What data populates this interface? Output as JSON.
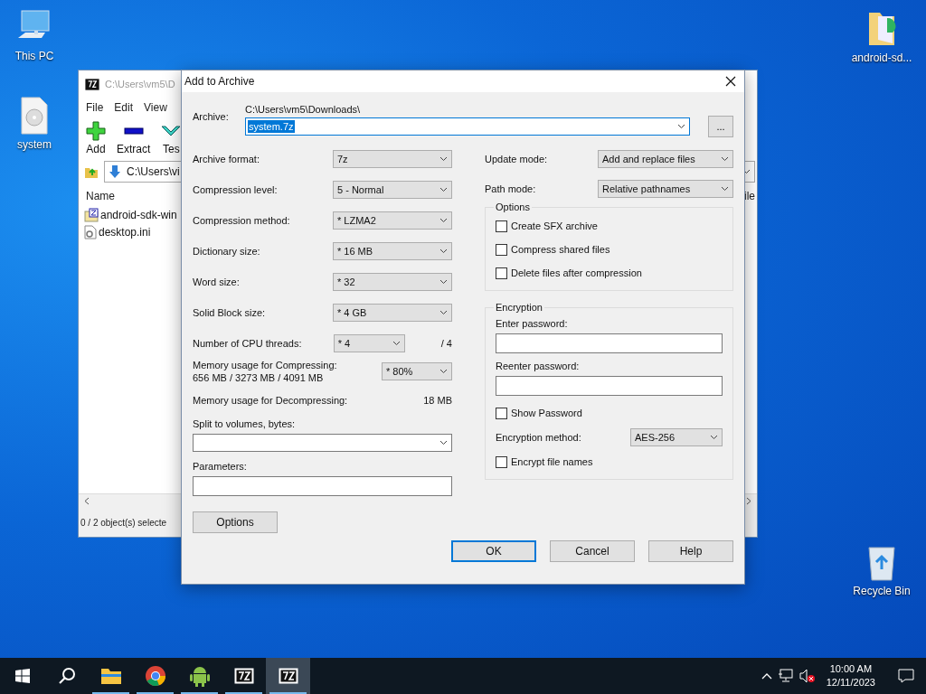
{
  "desktop_icons": [
    {
      "label": "This PC",
      "kind": "computer"
    },
    {
      "label": "system",
      "kind": "disc-file"
    },
    {
      "label": "android-sd...",
      "kind": "folder"
    },
    {
      "label": "Recycle Bin",
      "kind": "recycle-bin"
    }
  ],
  "background_window": {
    "title": "C:\\Users\\vm5\\D",
    "menu": [
      "File",
      "Edit",
      "View"
    ],
    "toolbar": [
      {
        "label": "Add",
        "kind": "add"
      },
      {
        "label": "Extract",
        "kind": "extract"
      },
      {
        "label": "Tes",
        "kind": "test"
      }
    ],
    "address": "C:\\Users\\vi",
    "columns": [
      "Name",
      "ile"
    ],
    "files": [
      {
        "name": "android-sdk-win",
        "kind": "archive"
      },
      {
        "name": "desktop.ini",
        "kind": "settings"
      }
    ],
    "status": "0 / 2 object(s) selecte"
  },
  "dialog": {
    "title": "Add to Archive",
    "archive": {
      "label": "Archive:",
      "path": "C:\\Users\\vm5\\Downloads\\",
      "value": "system.7z",
      "text_selected": true,
      "browse": "..."
    },
    "left_fields": [
      {
        "kind": "select",
        "label": "Archive format:",
        "value": "7z"
      },
      {
        "kind": "select",
        "label": "Compression level:",
        "value": "5 - Normal"
      },
      {
        "kind": "select",
        "label": "Compression method:",
        "value": "* LZMA2"
      },
      {
        "kind": "select",
        "label": "Dictionary size:",
        "value": "* 16 MB"
      },
      {
        "kind": "select",
        "label": "Word size:",
        "value": "* 32"
      },
      {
        "kind": "select",
        "label": "Solid Block size:",
        "value": "* 4 GB"
      },
      {
        "kind": "threads",
        "label": "Number of CPU threads:",
        "value": "* 4",
        "max": "/ 4"
      },
      {
        "kind": "memory",
        "label": "Memory usage for Compressing:",
        "detail": "656 MB / 3273 MB / 4091 MB",
        "value": "* 80%"
      },
      {
        "kind": "reading",
        "label": "Memory usage for Decompressing:",
        "value": "18 MB"
      },
      {
        "kind": "combo",
        "label": "Split to volumes, bytes:"
      },
      {
        "kind": "input",
        "label": "Parameters:"
      }
    ],
    "options_button": "Options",
    "update_mode": {
      "label": "Update mode:",
      "value": "Add and replace files"
    },
    "path_mode": {
      "label": "Path mode:",
      "value": "Relative pathnames"
    },
    "options_group": {
      "title": "Options",
      "checkboxes": [
        {
          "label": "Create SFX archive",
          "checked": false
        },
        {
          "label": "Compress shared files",
          "checked": false
        },
        {
          "label": "Delete files after compression",
          "checked": false
        }
      ]
    },
    "encryption": {
      "title": "Encryption",
      "password_label": "Enter password:",
      "reenter_label": "Reenter password:",
      "show_password": {
        "label": "Show Password",
        "checked": false
      },
      "method": {
        "label": "Encryption method:",
        "value": "AES-256"
      },
      "encrypt_names": {
        "label": "Encrypt file names",
        "checked": false
      }
    },
    "buttons": [
      {
        "label": "OK",
        "default": true
      },
      {
        "label": "Cancel",
        "default": false
      },
      {
        "label": "Help",
        "default": false
      }
    ]
  },
  "taskbar": {
    "apps": [
      {
        "kind": "explorer",
        "active": false
      },
      {
        "kind": "chrome",
        "active": false
      },
      {
        "kind": "android",
        "active": false
      },
      {
        "kind": "sevenzip",
        "active": false
      },
      {
        "kind": "sevenzip",
        "active": true
      }
    ],
    "time": "10:00 AM",
    "date": "12/11/2023"
  }
}
